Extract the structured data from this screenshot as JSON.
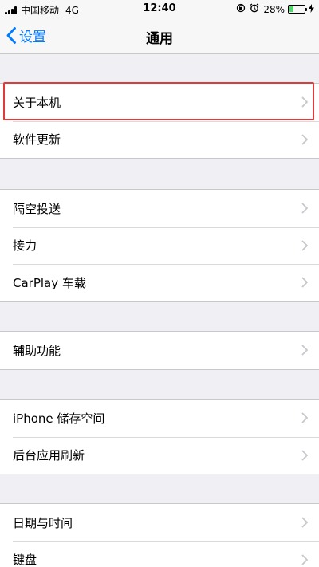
{
  "status_bar": {
    "carrier": "中国移动",
    "network": "4G",
    "time": "12:40",
    "battery_percent": "28%",
    "battery_level": 0.28
  },
  "nav": {
    "back_label": "设置",
    "title": "通用"
  },
  "groups": [
    {
      "items": [
        {
          "label": "关于本机"
        },
        {
          "label": "软件更新"
        }
      ]
    },
    {
      "items": [
        {
          "label": "隔空投送"
        },
        {
          "label": "接力"
        },
        {
          "label": "CarPlay 车载"
        }
      ]
    },
    {
      "items": [
        {
          "label": "辅助功能"
        }
      ]
    },
    {
      "items": [
        {
          "label": "iPhone 储存空间"
        },
        {
          "label": "后台应用刷新"
        }
      ]
    },
    {
      "items": [
        {
          "label": "日期与时间"
        },
        {
          "label": "键盘"
        }
      ]
    }
  ],
  "colors": {
    "accent": "#007aff",
    "highlight": "#e03b3b",
    "background": "#efeff4"
  },
  "icons": [
    "signal-icon",
    "orientation-lock-icon",
    "alarm-icon",
    "battery-icon",
    "charging-icon",
    "back-chevron-icon",
    "disclosure-chevron-icon"
  ]
}
